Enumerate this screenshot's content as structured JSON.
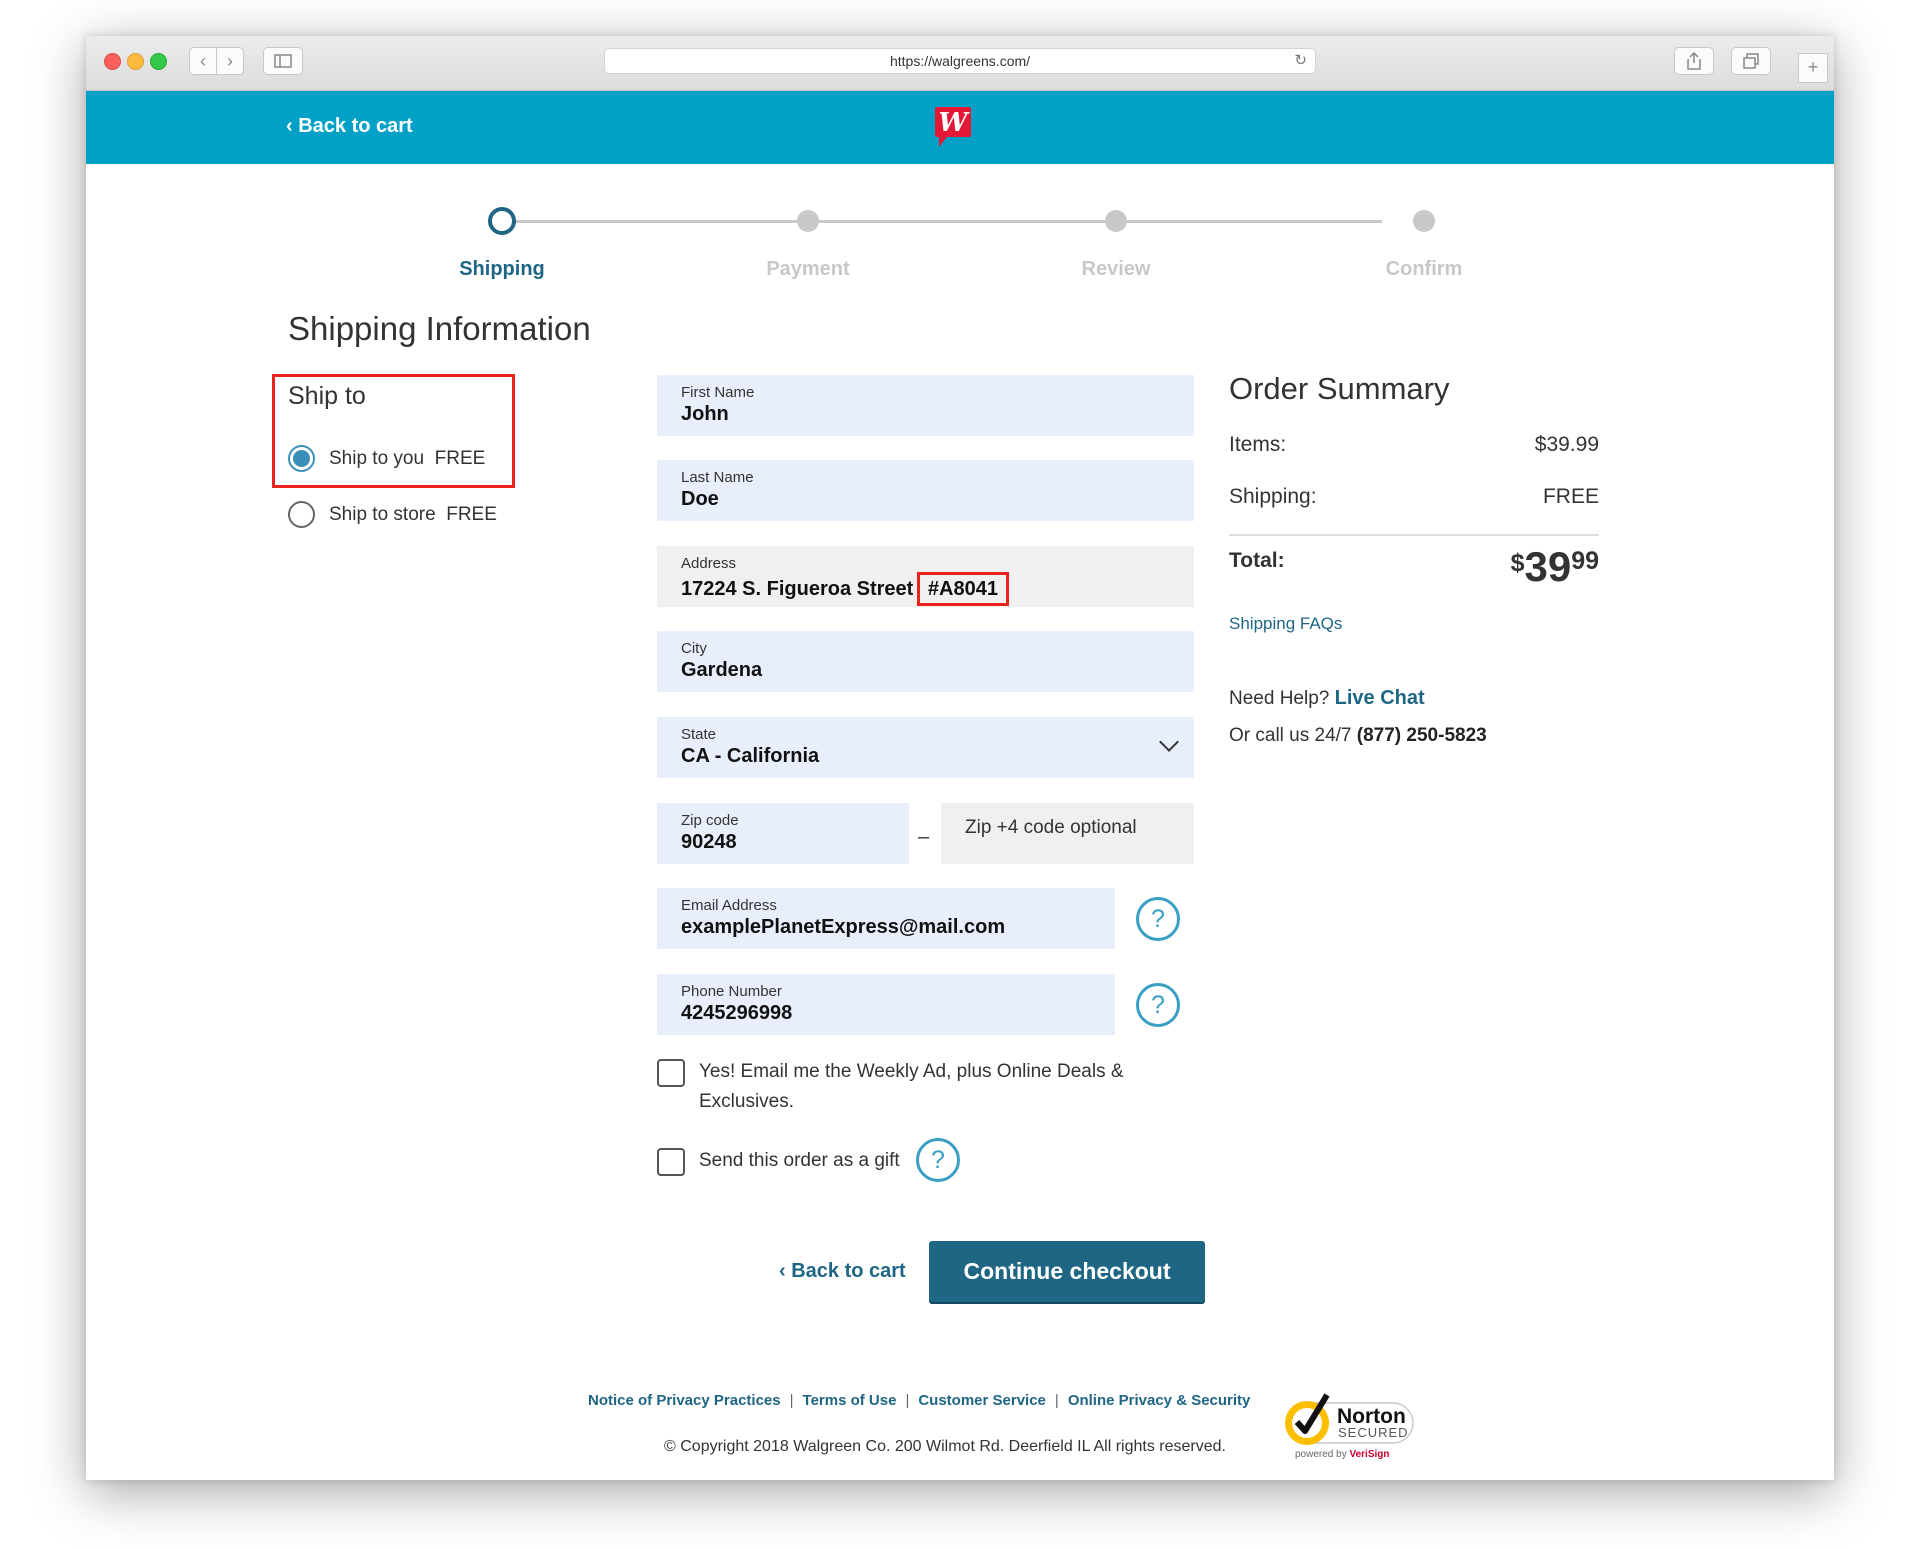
{
  "browser": {
    "url": "https://walgreens.com/"
  },
  "header": {
    "back_link": "‹ Back to cart",
    "logo_letter": "W"
  },
  "stepper": {
    "steps": [
      {
        "label": "Shipping",
        "active": true
      },
      {
        "label": "Payment",
        "active": false
      },
      {
        "label": "Review",
        "active": false
      },
      {
        "label": "Confirm",
        "active": false
      }
    ]
  },
  "page_title": "Shipping Information",
  "ship_to": {
    "title": "Ship to",
    "options": [
      {
        "label": "Ship to you",
        "price": "FREE",
        "selected": true
      },
      {
        "label": "Ship to store",
        "price": "FREE",
        "selected": false
      }
    ]
  },
  "form": {
    "first_name": {
      "label": "First Name",
      "value": "John"
    },
    "last_name": {
      "label": "Last Name",
      "value": "Doe"
    },
    "address": {
      "label": "Address",
      "value": "17224 S. Figueroa Street",
      "highlight": "#A8041"
    },
    "city": {
      "label": "City",
      "value": "Gardena"
    },
    "state": {
      "label": "State",
      "value": "CA - California"
    },
    "zip": {
      "label": "Zip code",
      "value": "90248",
      "dash": "–"
    },
    "zip4": {
      "placeholder": "Zip +4 code optional"
    },
    "email": {
      "label": "Email Address",
      "value": "examplePlanetExpress@mail.com"
    },
    "phone": {
      "label": "Phone Number",
      "value": "4245296998"
    },
    "help_glyph": "?",
    "weekly_ad": "Yes! Email me the Weekly Ad, plus Online Deals & Exclusives.",
    "gift": "Send this order as a gift",
    "back_to_cart": "‹ Back to cart",
    "continue": "Continue checkout"
  },
  "summary": {
    "title": "Order Summary",
    "items_label": "Items:",
    "items_value": "$39.99",
    "shipping_label": "Shipping:",
    "shipping_value": "FREE",
    "total_label": "Total:",
    "total_currency": "$",
    "total_dollars": "39",
    "total_cents": "99",
    "faq_link": "Shipping FAQs",
    "help_prefix": "Need Help?",
    "live_chat": "Live Chat",
    "call_prefix": "Or call us 24/7",
    "phone": "(877) 250-5823"
  },
  "footer": {
    "links": [
      "Notice of Privacy Practices",
      "Terms of Use",
      "Customer Service",
      "Online Privacy & Security"
    ],
    "copyright": "© Copyright 2018 Walgreen Co. 200 Wilmot Rd. Deerfield IL All rights reserved.",
    "norton_name": "Norton",
    "norton_secured": "SECURED",
    "norton_powered": "powered by",
    "norton_verisign": "VeriSign"
  },
  "colors": {
    "header_bg": "#01a0c6",
    "primary": "#1f6685",
    "highlight_box": "#e8221c",
    "field_bg": "#e8eefc"
  }
}
